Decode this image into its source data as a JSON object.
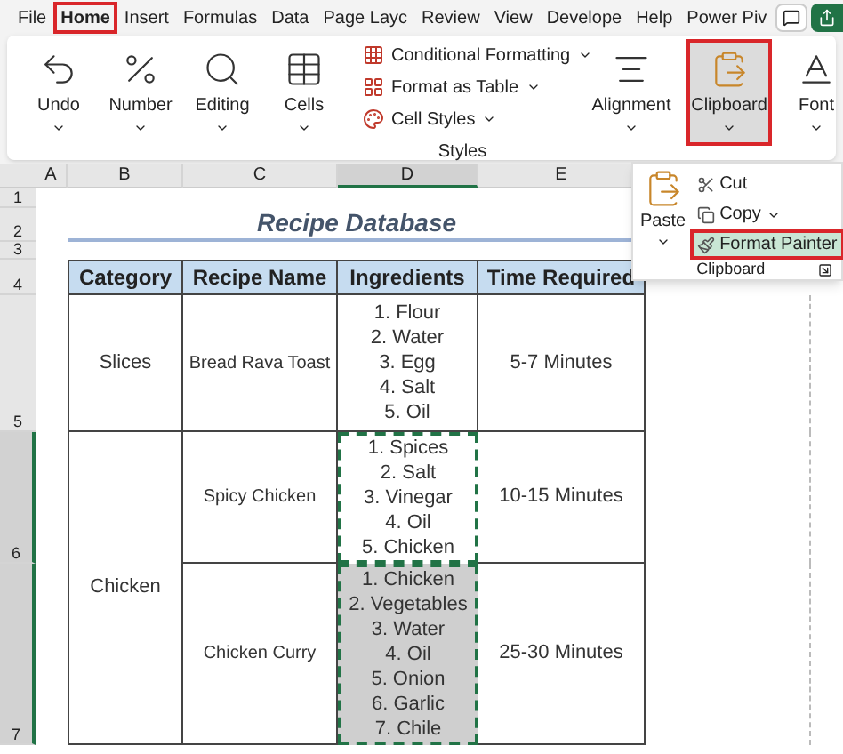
{
  "tabs": [
    {
      "label": "File",
      "selected": false
    },
    {
      "label": "Home",
      "selected": true
    },
    {
      "label": "Insert",
      "selected": false
    },
    {
      "label": "Formulas",
      "selected": false
    },
    {
      "label": "Data",
      "selected": false
    },
    {
      "label": "Page Layc",
      "selected": false
    },
    {
      "label": "Review",
      "selected": false
    },
    {
      "label": "View",
      "selected": false
    },
    {
      "label": "Develope",
      "selected": false
    },
    {
      "label": "Help",
      "selected": false
    },
    {
      "label": "Power Piv",
      "selected": false
    }
  ],
  "ribbon": {
    "groups": [
      {
        "kind": "undo",
        "label": "Undo",
        "selected": false
      },
      {
        "kind": "number",
        "label": "Number",
        "selected": false
      },
      {
        "kind": "editing",
        "label": "Editing",
        "selected": false
      },
      {
        "kind": "cells",
        "label": "Cells",
        "selected": false
      },
      {
        "kind": "styles",
        "label": "Styles",
        "items": [
          "Conditional Formatting",
          "Format as Table",
          "Cell Styles"
        ]
      },
      {
        "kind": "alignment",
        "label": "Alignment",
        "selected": false
      },
      {
        "kind": "clipboard",
        "label": "Clipboard",
        "selected": true
      },
      {
        "kind": "font",
        "label": "Font",
        "selected": false
      }
    ]
  },
  "clipboard_menu": {
    "paste": "Paste",
    "items": [
      {
        "kind": "cut",
        "label": "Cut",
        "selected": false
      },
      {
        "kind": "copy",
        "label": "Copy",
        "selected": false
      },
      {
        "kind": "format-painter",
        "label": "Format Painter",
        "selected": true
      }
    ],
    "group_label": "Clipboard"
  },
  "sheet": {
    "columns": [
      {
        "label": "A",
        "selected": false
      },
      {
        "label": "B",
        "selected": false
      },
      {
        "label": "C",
        "selected": false
      },
      {
        "label": "D",
        "selected": true
      },
      {
        "label": "E",
        "selected": false
      }
    ],
    "row_numbers": [
      {
        "label": "1",
        "selected": false
      },
      {
        "label": "2",
        "selected": false
      },
      {
        "label": "3",
        "selected": false
      },
      {
        "label": "4",
        "selected": false
      },
      {
        "label": "5",
        "selected": false
      },
      {
        "label": "6",
        "selected": true
      },
      {
        "label": "7",
        "selected": true
      }
    ]
  },
  "table": {
    "title": "Recipe Database",
    "columns": [
      "Category",
      "Recipe Name",
      "Ingredients",
      "Time Required"
    ],
    "groups": [
      {
        "category": "Slices",
        "recipes": [
          {
            "name": "Bread Rava Toast",
            "ingredients": [
              "1. Flour",
              "2. Water",
              "3. Egg",
              "4. Salt",
              "5. Oil"
            ],
            "time": "5-7 Minutes",
            "copied": false,
            "shaded": false
          }
        ]
      },
      {
        "category": "Chicken",
        "recipes": [
          {
            "name": "Spicy Chicken",
            "ingredients": [
              "1. Spices",
              "2. Salt",
              "3. Vinegar",
              "4. Oil",
              "5. Chicken"
            ],
            "time": "10-15 Minutes",
            "copied": true,
            "shaded": false
          },
          {
            "name": "Chicken Curry",
            "ingredients": [
              "1. Chicken",
              "2. Vegetables",
              "3. Water",
              "4. Oil",
              "5. Onion",
              "6. Garlic",
              "7. Chile"
            ],
            "time": "25-30 Minutes",
            "copied": true,
            "shaded": true
          }
        ]
      }
    ]
  }
}
